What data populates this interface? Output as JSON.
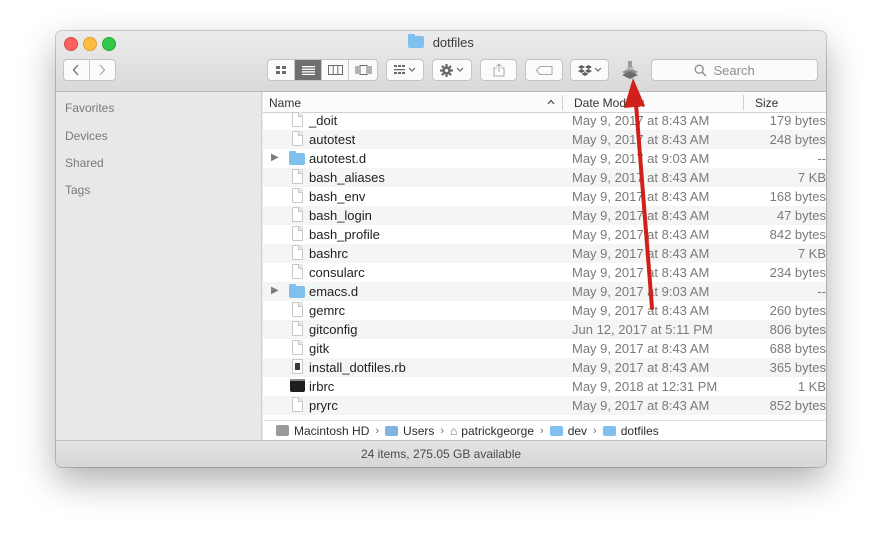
{
  "window": {
    "title": "dotfiles"
  },
  "search": {
    "placeholder": "Search"
  },
  "sidebar": {
    "items": [
      "Favorites",
      "Devices",
      "Shared",
      "Tags"
    ]
  },
  "columns": {
    "name": "Name",
    "date": "Date Modified",
    "size": "Size"
  },
  "files": [
    {
      "name": "_doit",
      "date": "May 9, 2017 at 8:43 AM",
      "size": "179 bytes",
      "icon": "doc-icon"
    },
    {
      "name": "autotest",
      "date": "May 9, 2017 at 8:43 AM",
      "size": "248 bytes",
      "icon": "doc-icon"
    },
    {
      "name": "autotest.d",
      "date": "May 9, 2017 at 9:03 AM",
      "size": "--",
      "icon": "folder-icon",
      "disclosure": "▶"
    },
    {
      "name": "bash_aliases",
      "date": "May 9, 2017 at 8:43 AM",
      "size": "7 KB",
      "icon": "doc-icon"
    },
    {
      "name": "bash_env",
      "date": "May 9, 2017 at 8:43 AM",
      "size": "168 bytes",
      "icon": "doc-icon"
    },
    {
      "name": "bash_login",
      "date": "May 9, 2017 at 8:43 AM",
      "size": "47 bytes",
      "icon": "doc-icon"
    },
    {
      "name": "bash_profile",
      "date": "May 9, 2017 at 8:43 AM",
      "size": "842 bytes",
      "icon": "doc-icon"
    },
    {
      "name": "bashrc",
      "date": "May 9, 2017 at 8:43 AM",
      "size": "7 KB",
      "icon": "doc-icon"
    },
    {
      "name": "consularc",
      "date": "May 9, 2017 at 8:43 AM",
      "size": "234 bytes",
      "icon": "doc-icon"
    },
    {
      "name": "emacs.d",
      "date": "May 9, 2017 at 9:03 AM",
      "size": "--",
      "icon": "folder-icon",
      "disclosure": "▶"
    },
    {
      "name": "gemrc",
      "date": "May 9, 2017 at 8:43 AM",
      "size": "260 bytes",
      "icon": "doc-icon"
    },
    {
      "name": "gitconfig",
      "date": "Jun 12, 2017 at 5:11 PM",
      "size": "806 bytes",
      "icon": "doc-icon"
    },
    {
      "name": "gitk",
      "date": "May 9, 2017 at 8:43 AM",
      "size": "688 bytes",
      "icon": "doc-icon"
    },
    {
      "name": "install_dotfiles.rb",
      "date": "May 9, 2017 at 8:43 AM",
      "size": "365 bytes",
      "icon": "ruby-file-icon"
    },
    {
      "name": "irbrc",
      "date": "May 9, 2018 at 12:31 PM",
      "size": "1 KB",
      "icon": "terminal-icon"
    },
    {
      "name": "pryrc",
      "date": "May 9, 2017 at 8:43 AM",
      "size": "852 bytes",
      "icon": "doc-icon"
    }
  ],
  "path": [
    {
      "label": "Macintosh HD",
      "icon": "hard-drive-icon"
    },
    {
      "label": "Users",
      "icon": "users-folder-icon"
    },
    {
      "label": "patrickgeorge",
      "icon": "home-icon"
    },
    {
      "label": "dev",
      "icon": "folder-icon"
    },
    {
      "label": "dotfiles",
      "icon": "folder-icon"
    }
  ],
  "status": {
    "text": "24 items, 275.05 GB available"
  },
  "colors": {
    "annotation_arrow": "#d0201a",
    "folder": "#7fc0ee",
    "close": "#fc615d",
    "minimize": "#fdbc40",
    "maximize": "#34c84a"
  }
}
